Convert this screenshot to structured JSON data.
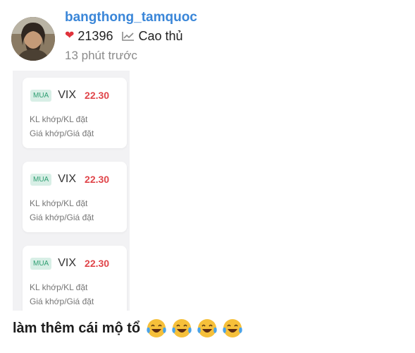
{
  "post": {
    "username": "bangthong_tamquoc",
    "likes": "21396",
    "rank": "Cao thủ",
    "time": "13 phút trước",
    "caption": "làm thêm cái mộ tổ",
    "caption_emoji": [
      "laughing-tears-icon",
      "laughing-tears-icon",
      "laughing-tears-icon",
      "laughing-tears-icon"
    ]
  },
  "orders": [
    {
      "side": "MUA",
      "ticker": "VIX",
      "price": "22.30",
      "line1": "KL khớp/KL đặt",
      "line2": "Giá khớp/Giá đặt"
    },
    {
      "side": "MUA",
      "ticker": "VIX",
      "price": "22.30",
      "line1": "KL khớp/KL đặt",
      "line2": "Giá khớp/Giá đặt"
    },
    {
      "side": "MUA",
      "ticker": "VIX",
      "price": "22.30",
      "line1": "KL khớp/KL đặt",
      "line2": "Giá khớp/Giá đặt"
    }
  ],
  "colors": {
    "username": "#3a86d8",
    "heart": "#e0323b",
    "badge_bg": "#d8efe6",
    "badge_text": "#2f9e72",
    "price": "#e0454a"
  }
}
